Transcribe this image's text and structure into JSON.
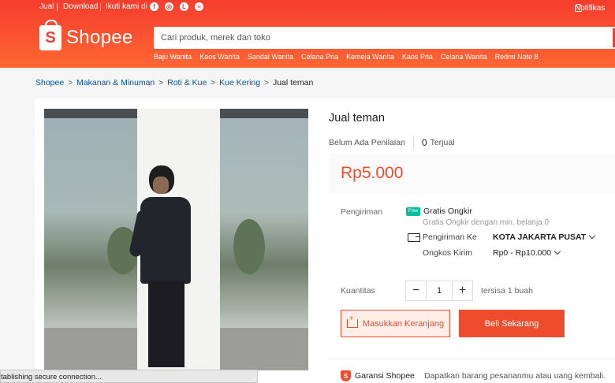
{
  "topbar": {
    "sell": "Jual",
    "download": "Download",
    "follow": "Ikuti kami di",
    "social_icons": [
      "facebook-icon",
      "instagram-icon",
      "line-icon",
      "chat-icon"
    ],
    "notifications": "Notifikas"
  },
  "header": {
    "logo_text": "Shopee",
    "search_placeholder": "Cari produk, merek dan toko",
    "hot_searches": [
      "Baju Wanita",
      "Kaos Wanita",
      "Sandal Wanita",
      "Celana Pria",
      "Kemeja Wanita",
      "Kaos Pria",
      "Celana Wanita",
      "Redmi Note 8"
    ]
  },
  "breadcrumb": [
    "Shopee",
    "Makanan & Minuman",
    "Roti & Kue",
    "Kue Kering",
    "Jual teman"
  ],
  "product": {
    "title": "Jual teman",
    "rating_text": "Belum Ada Penilaian",
    "sold_count": "0",
    "sold_label": "Terjual",
    "price": "Rp5.000"
  },
  "shipping": {
    "label": "Pengiriman",
    "free_badge": "Free",
    "free_title": "Gratis Ongkir",
    "free_sub": "Gratis Ongkir dengan min. belanja 0",
    "to_label": "Pengiriman Ke",
    "to_value": "KOTA JAKARTA PUSAT",
    "cost_label": "Ongkos Kirim",
    "cost_value": "Rp0 - Rp10.000"
  },
  "quantity": {
    "label": "Kuantitas",
    "minus": "−",
    "value": "1",
    "plus": "+",
    "stock": "tersisa 1 buah"
  },
  "actions": {
    "add_to_cart": "Masukkan Keranjang",
    "buy_now": "Beli Sekarang"
  },
  "guarantee": {
    "title": "Garansi Shopee",
    "description": "Dapatkan barang pesananmu atau uang kembali."
  },
  "status_bar": "tablishing secure connection..."
}
